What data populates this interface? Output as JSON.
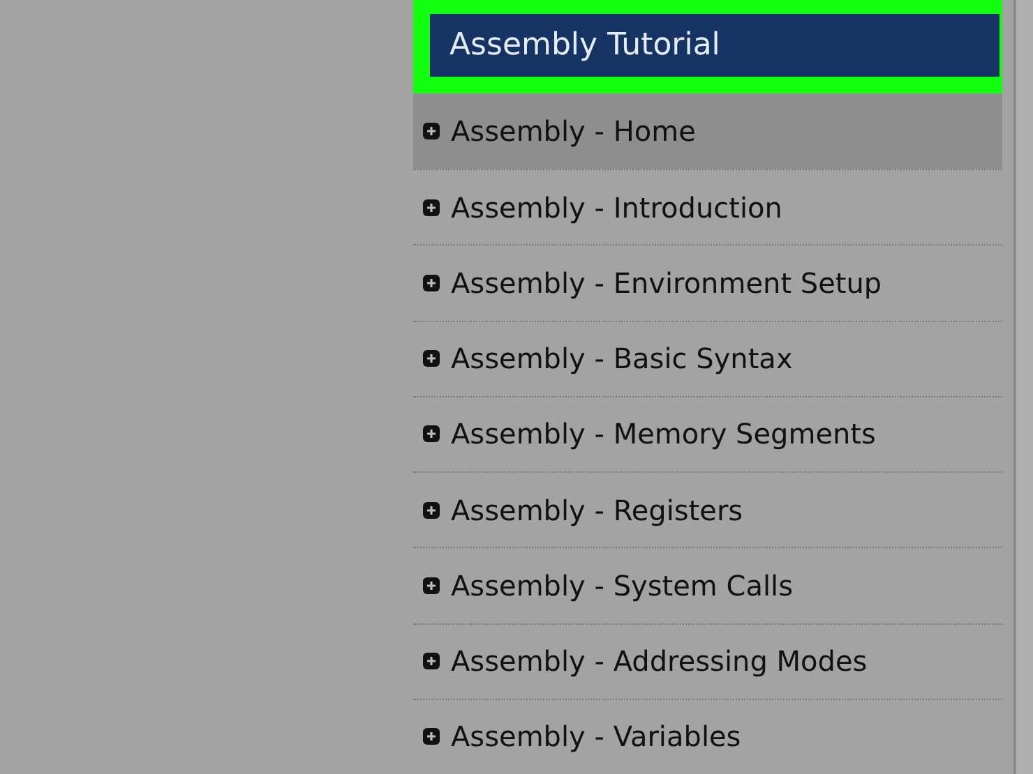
{
  "sidebar": {
    "title": "Assembly Tutorial",
    "items": [
      {
        "label": "Assembly - Home",
        "selected": true
      },
      {
        "label": "Assembly - Introduction",
        "selected": false
      },
      {
        "label": "Assembly - Environment Setup",
        "selected": false
      },
      {
        "label": "Assembly - Basic Syntax",
        "selected": false
      },
      {
        "label": "Assembly - Memory Segments",
        "selected": false
      },
      {
        "label": "Assembly - Registers",
        "selected": false
      },
      {
        "label": "Assembly - System Calls",
        "selected": false
      },
      {
        "label": "Assembly - Addressing Modes",
        "selected": false
      },
      {
        "label": "Assembly - Variables",
        "selected": false
      }
    ]
  }
}
